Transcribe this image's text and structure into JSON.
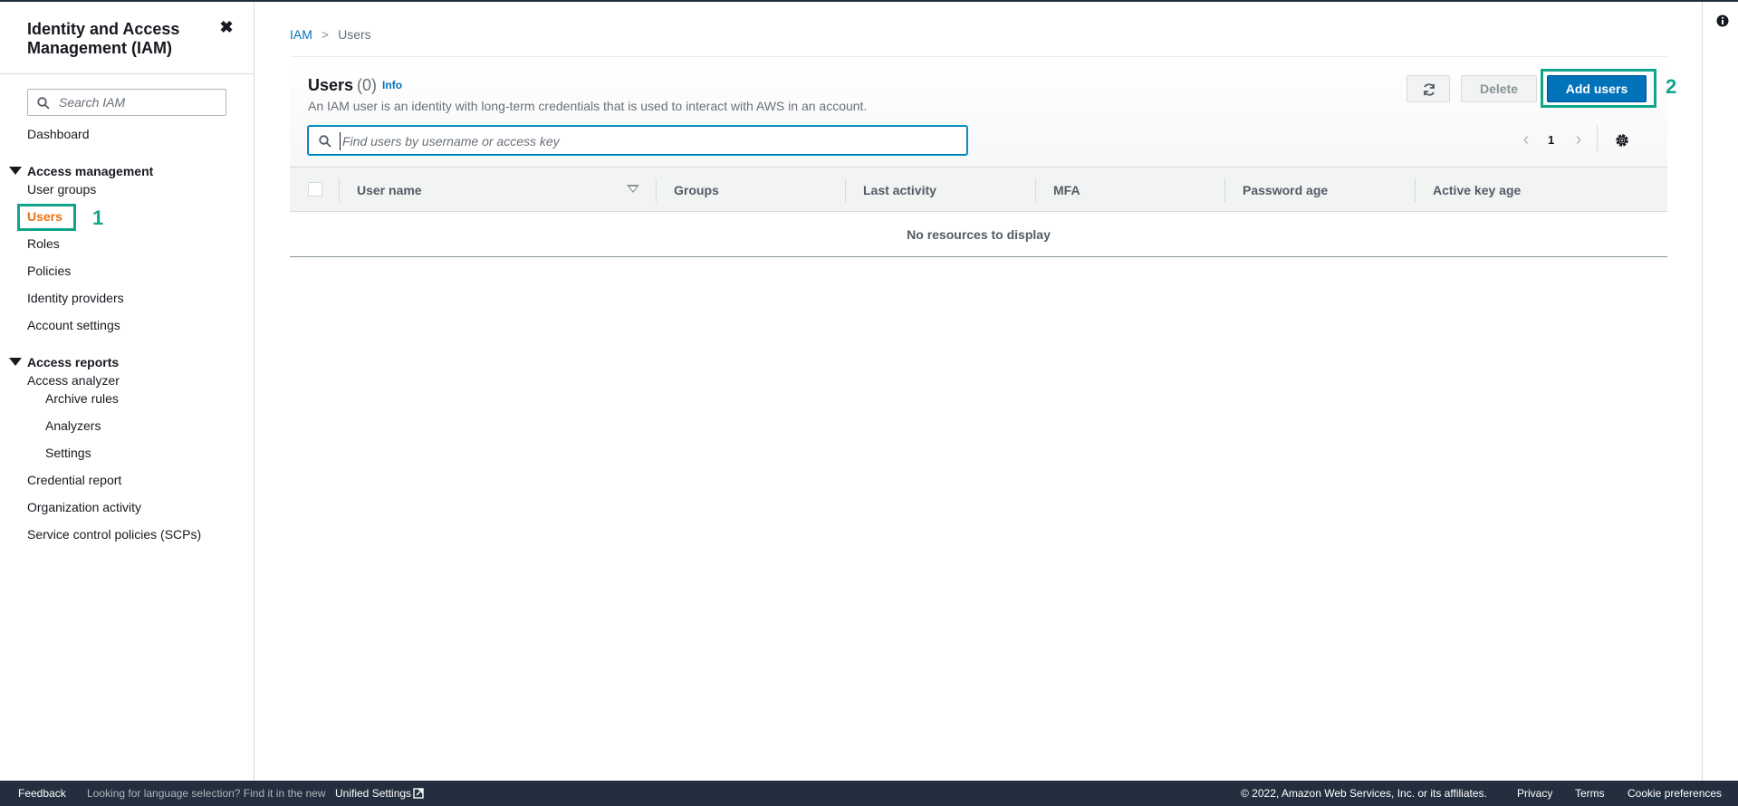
{
  "sidebar": {
    "title": "Identity and Access Management (IAM)",
    "search_placeholder": "Search IAM",
    "dashboard": "Dashboard",
    "access_management": {
      "heading": "Access management",
      "items": [
        "User groups",
        "Users",
        "Roles",
        "Policies",
        "Identity providers",
        "Account settings"
      ]
    },
    "access_reports": {
      "heading": "Access reports",
      "analyzer": "Access analyzer",
      "analyzer_sub": [
        "Archive rules",
        "Analyzers",
        "Settings"
      ],
      "items": [
        "Credential report",
        "Organization activity",
        "Service control policies (SCPs)"
      ]
    },
    "annotation_1": "1"
  },
  "breadcrumb": {
    "root": "IAM",
    "current": "Users"
  },
  "panel": {
    "title": "Users",
    "count": "(0)",
    "info": "Info",
    "description": "An IAM user is an identity with long-term credentials that is used to interact with AWS in an account.",
    "delete_label": "Delete",
    "add_label": "Add users",
    "annotation_2": "2",
    "find_placeholder": "Find users by username or access key",
    "page": "1"
  },
  "table": {
    "columns": [
      "User name",
      "Groups",
      "Last activity",
      "MFA",
      "Password age",
      "Active key age"
    ],
    "empty": "No resources to display"
  },
  "footer": {
    "feedback": "Feedback",
    "lang_prompt": "Looking for language selection? Find it in the new",
    "unified": "Unified Settings",
    "copyright": "© 2022, Amazon Web Services, Inc. or its affiliates.",
    "privacy": "Privacy",
    "terms": "Terms",
    "cookie": "Cookie preferences"
  },
  "colors": {
    "primary": "#0073bb",
    "active_nav": "#ec7211",
    "annotation": "#10a58a",
    "footer_bg": "#232f3e"
  }
}
